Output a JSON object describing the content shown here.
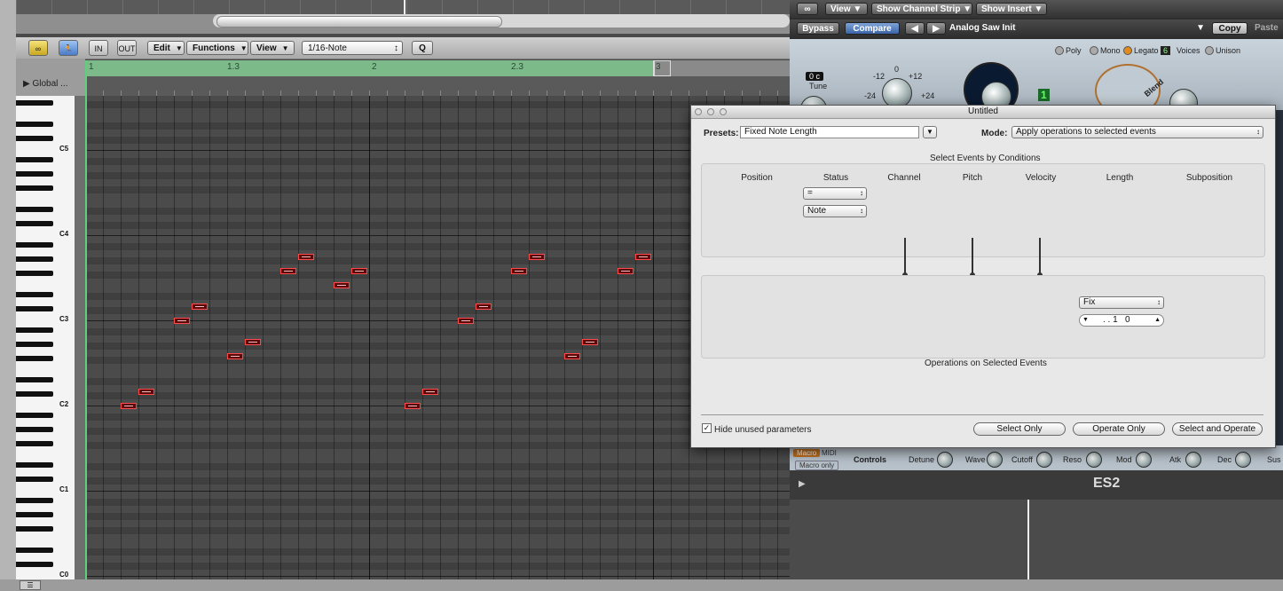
{
  "piano_roll": {
    "toolbar": {
      "edit": "Edit",
      "functions": "Functions",
      "view": "View",
      "quantize": "1/16-Note",
      "q": "Q",
      "in": "IN",
      "out": "OUT"
    },
    "global": "Global ...",
    "ruler": [
      "1",
      "1.3",
      "2",
      "2.3",
      "3"
    ],
    "octaves": [
      "C5",
      "C4",
      "C3",
      "C2",
      "C1",
      "C0"
    ]
  },
  "plugin": {
    "view": "View",
    "show_channel_strip": "Show Channel Strip",
    "show_insert": "Show Insert",
    "bypass": "Bypass",
    "compare": "Compare",
    "preset_name": "Analog Saw Init",
    "copy": "Copy",
    "paste": "Paste",
    "voice_modes": [
      "Poly",
      "Mono",
      "Legato"
    ],
    "voices_count": "6",
    "voices_label": "Voices",
    "unison": "Unison",
    "tune_value": "0 c",
    "tune_label": "Tune",
    "knob_ticks": [
      "-12",
      "0",
      "+12",
      "-24",
      "+24"
    ],
    "blend": "Blend",
    "osc_number": "1",
    "macro": "Macro",
    "midi": "MIDI",
    "macro_only": "Macro only",
    "controls": "Controls",
    "macro_knobs": [
      "Detune",
      "Wave",
      "Cutoff",
      "Reso",
      "Mod",
      "Atk",
      "Dec",
      "Sus"
    ],
    "footer_name": "ES2"
  },
  "dialog": {
    "title": "Untitled",
    "presets_label": "Presets:",
    "preset_value": "Fixed Note Length",
    "mode_label": "Mode:",
    "mode_value": "Apply operations to selected events",
    "select_section": "Select Events by Conditions",
    "columns": [
      "Position",
      "Status",
      "Channel",
      "Pitch",
      "Velocity",
      "Length",
      "Subposition"
    ],
    "status_condition": "=",
    "status_value": "Note",
    "length_op": "Fix",
    "length_value": ". . 1   0",
    "operations_section": "Operations on Selected Events",
    "hide_unused": "Hide unused parameters",
    "select_only": "Select Only",
    "operate_only": "Operate Only",
    "select_and_operate": "Select and Operate"
  }
}
